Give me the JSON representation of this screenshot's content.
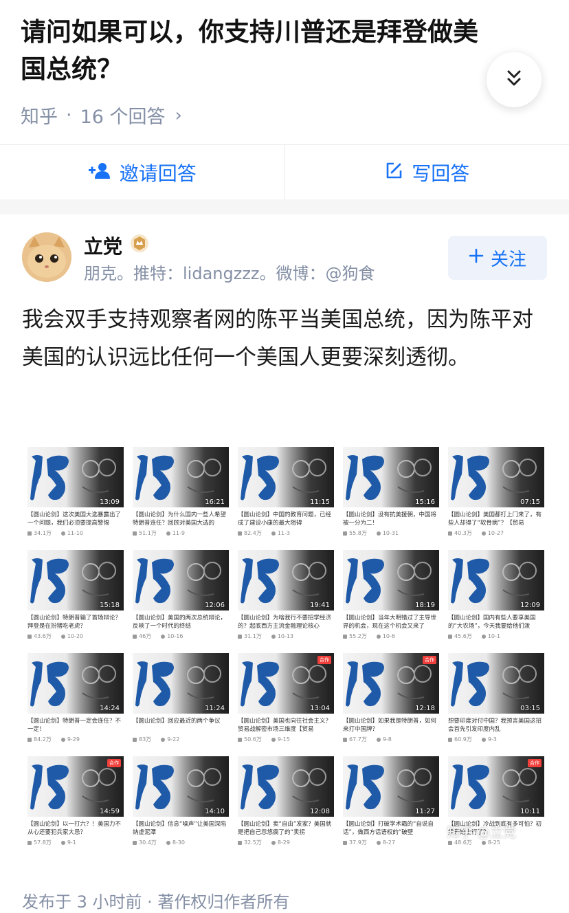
{
  "question": {
    "title": "请问如果可以，你支持川普还是拜登做美国总统？",
    "source": "知乎",
    "separator": "·",
    "answer_count": "16 个回答",
    "arrow": "›"
  },
  "actions": {
    "invite_label": "邀请回答",
    "write_label": "写回答"
  },
  "author": {
    "name": "立党",
    "bio": "朋克。推特：lidangzzz。微博：@狗食",
    "follow_label": "关注"
  },
  "answer": {
    "text": "我会双手支持观察者网的陈平当美国总统，因为陈平对美国的认识远比任何一个美国人更要深刻透彻。"
  },
  "videos": [
    {
      "duration": "13:09",
      "title": "【圆山论剑】这次美国大选暴露出了一个问题，我们必须要提高警惕",
      "views": "34.1万",
      "date": "11-10",
      "badge": ""
    },
    {
      "duration": "16:21",
      "title": "【圆山论剑】为什么国内一些人希望特朗普连任？回顾对美国大选的",
      "views": "51.1万",
      "date": "11-9",
      "badge": ""
    },
    {
      "duration": "11:15",
      "title": "【圆山论剑】中国的教育问题，已经成了建设小康的最大阻碍",
      "views": "82.4万",
      "date": "11-3",
      "badge": ""
    },
    {
      "duration": "15:16",
      "title": "【圆山论剑】没有抗美援朝，中国将被一分为二！",
      "views": "55.8万",
      "date": "10-31",
      "badge": ""
    },
    {
      "duration": "07:15",
      "title": "【圆山论剑】美国都打上门来了，有些人却得了“软骨病”？【贸易",
      "views": "40.3万",
      "date": "10-27",
      "badge": ""
    },
    {
      "duration": "15:18",
      "title": "【圆山论剑】特朗普输了首场辩论？拜登是在扮猪吃老虎？",
      "views": "43.6万",
      "date": "10-20",
      "badge": ""
    },
    {
      "duration": "12:06",
      "title": "【圆山论剑】美国的两次总统辩论，反映了一个时代的终结",
      "views": "46万",
      "date": "10-16",
      "badge": ""
    },
    {
      "duration": "19:41",
      "title": "【圆山论剑】为啥我行不要招学经济的？起底西方主流金融理论核心",
      "views": "31.1万",
      "date": "10-13",
      "badge": ""
    },
    {
      "duration": "18:19",
      "title": "【圆山论剑】当年大明错过了主导世界的机会，现在这个机会又来了",
      "views": "55.2万",
      "date": "10-6",
      "badge": ""
    },
    {
      "duration": "12:09",
      "title": "【圆山论剑】国内有些人要享美国的“大农场”，今天我要给他们泼",
      "views": "45.6万",
      "date": "10-1",
      "badge": ""
    },
    {
      "duration": "14:24",
      "title": "【圆山论剑】特朗普一定会连任？不一定！",
      "views": "84.2万",
      "date": "9-29",
      "badge": ""
    },
    {
      "duration": "11:24",
      "title": "【圆山论剑】回应最近的两个争议",
      "views": "83万",
      "date": "9-22",
      "badge": ""
    },
    {
      "duration": "13:04",
      "title": "【圆山论剑】美国也向往社会主义？贸易战解密市场三维度【贸易",
      "views": "50.6万",
      "date": "9-15",
      "badge": "合作"
    },
    {
      "duration": "12:18",
      "title": "【圆山论剑】如果我是特朗普，如何来打中国牌？",
      "views": "67.7万",
      "date": "9-8",
      "badge": "合作"
    },
    {
      "duration": "03:15",
      "title": "想要印度对付中国？我预言美国这招会首先引发印度内乱",
      "views": "60.9万",
      "date": "9-3",
      "badge": ""
    },
    {
      "duration": "14:59",
      "title": "【圆山论剑】以一打六？！美国力不从心还要犯兵家大忌？",
      "views": "57.8万",
      "date": "9-1",
      "badge": "合作"
    },
    {
      "duration": "14:10",
      "title": "【圆山论剑】信息“噪声”让美国深陷纳虚泥潭",
      "views": "30.4万",
      "date": "8-30",
      "badge": ""
    },
    {
      "duration": "12:08",
      "title": "【圆山论剑】卖“自由”发家？美国就是把自己忽悠瘸了的“卖拐",
      "views": "32.5万",
      "date": "8-29",
      "badge": ""
    },
    {
      "duration": "11:27",
      "title": "【圆山论剑】打破学术霸的“自说自话”，做西方话语权的“破壁",
      "views": "37.9万",
      "date": "8-27",
      "badge": ""
    },
    {
      "duration": "10:11",
      "title": "【圆山论剑】冷战到底有多可怕？初步开始上行了？",
      "views": "48.6万",
      "date": "8-25",
      "badge": "合作"
    }
  ],
  "watermark": "知乎 @立党",
  "footer": {
    "published": "发布于 3 小时前 · 著作权归作者所有"
  },
  "colors": {
    "accent": "#1772f6",
    "meta": "#8590a6",
    "follow_bg": "#eef3fb",
    "badge": "#f1403c",
    "logo_blue": "#1f5aa8"
  }
}
